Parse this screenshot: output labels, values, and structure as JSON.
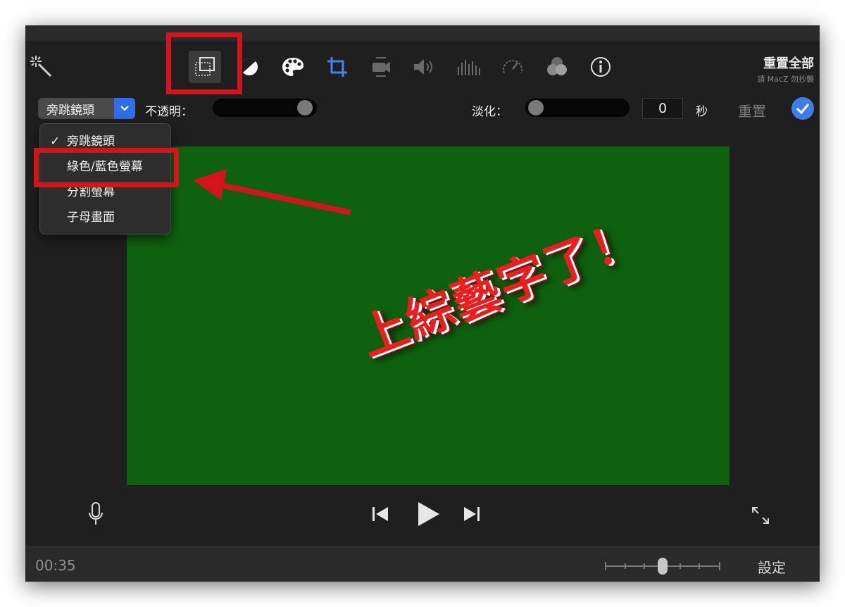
{
  "toolbar": {
    "reset_all_label": "重置全部",
    "watermark": "請 MacZ 勿抄襲",
    "icons": [
      "magic-wand-icon",
      "video-overlay-icon",
      "color-balance-icon",
      "color-palette-icon",
      "crop-icon",
      "stabilization-icon",
      "volume-icon",
      "equalizer-icon",
      "speed-icon",
      "noise-reduction-icon",
      "info-icon"
    ]
  },
  "controls": {
    "overlay_style_value": "旁跳鏡頭",
    "opacity_label": "不透明：",
    "opacity_value": 1.0,
    "fade_label": "淡化：",
    "fade_value": "0",
    "fade_unit": "秒",
    "reset_label": "重置"
  },
  "dropdown": {
    "items": [
      {
        "label": "旁跳鏡頭",
        "checked": true
      },
      {
        "label": "綠色/藍色螢幕",
        "checked": false
      },
      {
        "label": "分割螢幕",
        "checked": false
      },
      {
        "label": "子母畫面",
        "checked": false
      }
    ]
  },
  "viewer": {
    "overlay_text": "上綜藝字了！",
    "background_color": "#0e620f"
  },
  "status": {
    "timecode": "00:35",
    "settings_label": "設定"
  },
  "colors": {
    "accent": "#2f6ee6",
    "highlight": "#d3141a"
  }
}
